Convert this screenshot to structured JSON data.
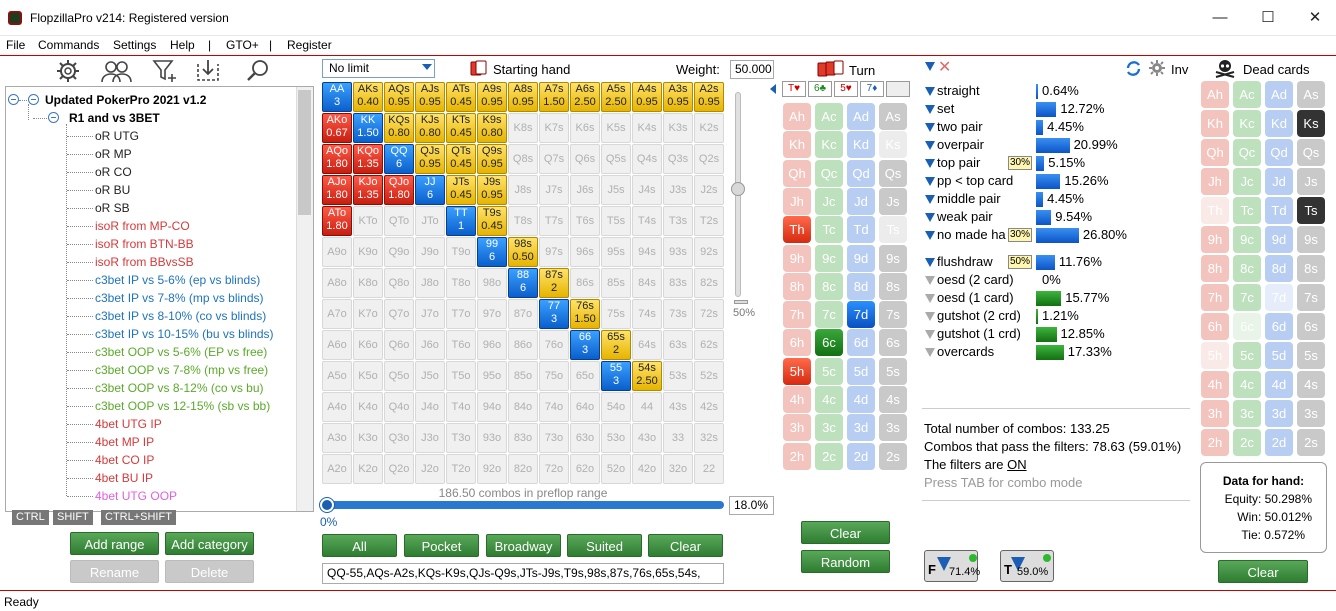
{
  "window": {
    "title": "FlopzillaPro v214: Registered version",
    "minimize": "—",
    "maximize": "☐",
    "close": "✕"
  },
  "menu": [
    "File",
    "Commands",
    "Settings",
    "Help",
    "|",
    "GTO+",
    "|",
    "Register"
  ],
  "tree": {
    "root": "Updated PokerPro 2021 v1.2",
    "group": "R1 and vs 3BET",
    "items": [
      {
        "label": "oR UTG",
        "color": "#222"
      },
      {
        "label": "oR MP",
        "color": "#222"
      },
      {
        "label": "oR CO",
        "color": "#222"
      },
      {
        "label": "oR BU",
        "color": "#222"
      },
      {
        "label": "oR SB",
        "color": "#222"
      },
      {
        "label": "isoR from MP-CO",
        "color": "#d63a3a"
      },
      {
        "label": "isoR from BTN-BB",
        "color": "#d63a3a"
      },
      {
        "label": "isoR from BBvsSB",
        "color": "#d63a3a"
      },
      {
        "label": "c3bet IP vs 5-6% (ep vs blinds)",
        "color": "#1e73be"
      },
      {
        "label": "c3bet IP vs 7-8% (mp vs blinds)",
        "color": "#1e73be"
      },
      {
        "label": "c3bet IP vs 8-10% (co vs blinds)",
        "color": "#1e73be"
      },
      {
        "label": "c3bet IP vs 10-15% (bu vs blinds)",
        "color": "#1e73be"
      },
      {
        "label": "c3bet OOP vs 5-6% (EP vs free)",
        "color": "#5aaa2a"
      },
      {
        "label": "c3bet OOP vs 7-8% (mp vs free)",
        "color": "#5aaa2a"
      },
      {
        "label": "c3bet OOP vs 8-12% (co vs bu)",
        "color": "#5aaa2a"
      },
      {
        "label": "c3bet OOP vs 12-15% (sb vs bb)",
        "color": "#5aaa2a"
      },
      {
        "label": "4bet UTG IP",
        "color": "#d63a3a"
      },
      {
        "label": "4bet MP IP",
        "color": "#d63a3a"
      },
      {
        "label": "4bet CO IP",
        "color": "#d63a3a"
      },
      {
        "label": "4bet BU IP",
        "color": "#d63a3a"
      },
      {
        "label": "4bet UTG OOP",
        "color": "#e060e0"
      }
    ]
  },
  "keys": [
    "CTRL",
    "SHIFT",
    "CTRL+SHIFT"
  ],
  "left_buttons": {
    "add_range": "Add range",
    "add_category": "Add category",
    "rename": "Rename",
    "delete": "Delete"
  },
  "range": {
    "limit": "No limit",
    "starting_hand": "Starting hand",
    "weight_label": "Weight:",
    "weight_value": "50.000",
    "slider_pct": "50%",
    "combos_text": "186.50 combos in preflop range",
    "range_pct": "18.0%",
    "zero_pct": "0%",
    "buttons": {
      "all": "All",
      "pocket": "Pocket",
      "broadway": "Broadway",
      "suited": "Suited",
      "clear": "Clear"
    },
    "range_text": "QQ-55,AQs-A2s,KQs-K9s,QJs-Q9s,JTs-J9s,T9s,98s,87s,76s,65s,54s,"
  },
  "grid": [
    [
      "AA|b|3",
      "AKs|y|0.40",
      "AQs|y|0.95",
      "AJs|y|0.95",
      "ATs|y|0.45",
      "A9s|y|0.95",
      "A8s|y|0.95",
      "A7s|y|1.50",
      "A6s|y|2.50",
      "A5s|y|2.50",
      "A4s|y|0.95",
      "A3s|y|0.95",
      "A2s|y|0.95"
    ],
    [
      "AKo|r|0.67",
      "KK|b|1.50",
      "KQs|y|0.80",
      "KJs|y|0.80",
      "KTs|y|0.45",
      "K9s|y|0.80",
      "K8s",
      "K7s",
      "K6s",
      "K5s",
      "K4s",
      "K3s",
      "K2s"
    ],
    [
      "AQo|r|1.80",
      "KQo|r|1.35",
      "QQ|b|6",
      "QJs|y|0.95",
      "QTs|y|0.45",
      "Q9s|y|0.95",
      "Q8s",
      "Q7s",
      "Q6s",
      "Q5s",
      "Q4s",
      "Q3s",
      "Q2s"
    ],
    [
      "AJo|r|1.80",
      "KJo|r|1.35",
      "QJo|r|1.80",
      "JJ|b|6",
      "JTs|y|0.45",
      "J9s|y|0.95",
      "J8s",
      "J7s",
      "J6s",
      "J5s",
      "J4s",
      "J3s",
      "J2s"
    ],
    [
      "ATo|r|1.80",
      "KTo",
      "QTo",
      "JTo",
      "TT|b|1",
      "T9s|y|0.45",
      "T8s",
      "T7s",
      "T6s",
      "T5s",
      "T4s",
      "T3s",
      "T2s"
    ],
    [
      "A9o",
      "K9o",
      "Q9o",
      "J9o",
      "T9o",
      "99|b|6",
      "98s|y|0.50",
      "97s",
      "96s",
      "95s",
      "94s",
      "93s",
      "92s"
    ],
    [
      "A8o",
      "K8o",
      "Q8o",
      "J8o",
      "T8o",
      "98o",
      "88|b|6",
      "87s|y|2",
      "86s",
      "85s",
      "84s",
      "83s",
      "82s"
    ],
    [
      "A7o",
      "K7o",
      "Q7o",
      "J7o",
      "T7o",
      "97o",
      "87o",
      "77|b|3",
      "76s|y|1.50",
      "75s",
      "74s",
      "73s",
      "72s"
    ],
    [
      "A6o",
      "K6o",
      "Q6o",
      "J6o",
      "T6o",
      "96o",
      "86o",
      "76o",
      "66|b|3",
      "65s|y|2",
      "64s",
      "63s",
      "62s"
    ],
    [
      "A5o",
      "K5o",
      "Q5o",
      "J5o",
      "T5o",
      "95o",
      "85o",
      "75o",
      "65o",
      "55|b|3",
      "54s|y|2.50",
      "53s",
      "52s"
    ],
    [
      "A4o",
      "K4o",
      "Q4o",
      "J4o",
      "T4o",
      "94o",
      "84o",
      "74o",
      "64o",
      "54o",
      "44",
      "43s",
      "42s"
    ],
    [
      "A3o",
      "K3o",
      "Q3o",
      "J3o",
      "T3o",
      "93o",
      "83o",
      "73o",
      "63o",
      "53o",
      "43o",
      "33",
      "32s"
    ],
    [
      "A2o",
      "K2o",
      "Q2o",
      "J2o",
      "T2o",
      "92o",
      "82o",
      "72o",
      "62o",
      "52o",
      "42o",
      "32o",
      "22"
    ]
  ],
  "turn": {
    "label": "Turn",
    "board": [
      "T♥",
      "6♣",
      "5♥",
      "7♦",
      ""
    ],
    "clear": "Clear",
    "random": "Random"
  },
  "board_cards": [
    [
      "Ah",
      "Ac",
      "Ad",
      "As"
    ],
    [
      "Kh",
      "Kc",
      "Kd",
      "Ks"
    ],
    [
      "Qh",
      "Qc",
      "Qd",
      "Qs"
    ],
    [
      "Jh",
      "Jc",
      "Jd",
      "Js"
    ],
    [
      "Th",
      "Tc",
      "Td",
      "Ts"
    ],
    [
      "9h",
      "9c",
      "9d",
      "9s"
    ],
    [
      "8h",
      "8c",
      "8d",
      "8s"
    ],
    [
      "7h",
      "7c",
      "7d",
      "7s"
    ],
    [
      "6h",
      "6c",
      "6d",
      "6s"
    ],
    [
      "5h",
      "5c",
      "5d",
      "5s"
    ],
    [
      "4h",
      "4c",
      "4d",
      "4s"
    ],
    [
      "3h",
      "3c",
      "3d",
      "3s"
    ],
    [
      "2h",
      "2c",
      "2d",
      "2s"
    ]
  ],
  "stats": {
    "inv": "Inv",
    "rows": [
      {
        "label": "straight",
        "val": "0.64%",
        "bar": 0.0064,
        "color": "b"
      },
      {
        "label": "set",
        "val": "12.72%",
        "bar": 0.1272,
        "color": "b"
      },
      {
        "label": "two pair",
        "val": "4.45%",
        "bar": 0.0445,
        "color": "b"
      },
      {
        "label": "overpair",
        "val": "20.99%",
        "bar": 0.2099,
        "color": "b"
      },
      {
        "label": "top pair",
        "val": "5.15%",
        "bar": 0.0515,
        "color": "b",
        "badge": "30%"
      },
      {
        "label": "pp < top card",
        "val": "15.26%",
        "bar": 0.1526,
        "color": "b"
      },
      {
        "label": "middle pair",
        "val": "4.45%",
        "bar": 0.0445,
        "color": "b"
      },
      {
        "label": "weak pair",
        "val": "9.54%",
        "bar": 0.0954,
        "color": "b"
      },
      {
        "label": "no made ha",
        "val": "26.80%",
        "bar": 0.268,
        "color": "b",
        "badge": "30%"
      }
    ],
    "draws": [
      {
        "label": "flushdraw",
        "val": "11.76%",
        "bar": 0.1176,
        "color": "b",
        "badge": "50%"
      },
      {
        "label": "oesd (2 card)",
        "val": "0%",
        "bar": 0,
        "color": "g"
      },
      {
        "label": "oesd (1 card)",
        "val": "15.77%",
        "bar": 0.1577,
        "color": "g"
      },
      {
        "label": "gutshot (2 crd)",
        "val": "1.21%",
        "bar": 0.0121,
        "color": "g"
      },
      {
        "label": "gutshot (1 crd)",
        "val": "12.85%",
        "bar": 0.1285,
        "color": "g"
      },
      {
        "label": "overcards",
        "val": "17.33%",
        "bar": 0.1733,
        "color": "g"
      }
    ],
    "total": "Total number of combos: 133.25",
    "pass": "Combos that pass the filters: 78.63 (59.01%)",
    "filters_are": "The filters are ",
    "filters_on": "ON",
    "tab_hint": "Press TAB for combo mode",
    "f_pct": "71.4%",
    "t_pct": "59.0%"
  },
  "dead": {
    "label": "Dead cards",
    "data_title": "Data for hand:",
    "equity": "Equity: 50.298%",
    "win": "Win: 50.012%",
    "tie": "Tie: 0.572%",
    "clear": "Clear"
  },
  "status": "Ready"
}
